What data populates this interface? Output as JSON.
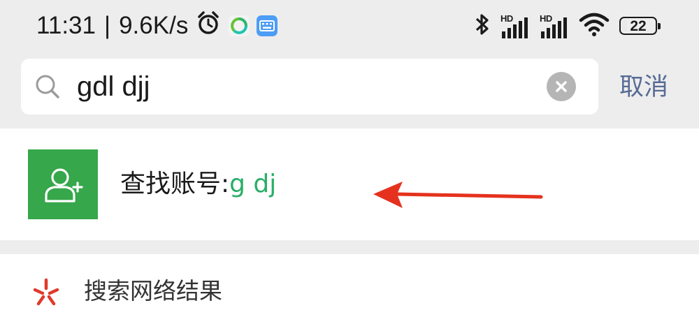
{
  "status_bar": {
    "time": "11:31",
    "separator": "|",
    "net_speed": "9.6K/s",
    "battery_percent": "22",
    "battery_level": 0.22,
    "icons": [
      "alarm-clock-icon",
      "green-app-icon",
      "keyboard-app-icon",
      "bluetooth-icon",
      "signal-hd-1-icon",
      "signal-hd-2-icon",
      "wifi-icon",
      "battery-icon"
    ],
    "signal_badge": "HD"
  },
  "search": {
    "query": "gdl djj",
    "icon": "search-icon",
    "clear_icon": "clear-icon",
    "cancel_label": "取消"
  },
  "result": {
    "icon": "add-friend-icon",
    "prefix": "查找账号:",
    "query_display": "g dj",
    "colors": {
      "icon_bg": "#36a74a",
      "query": "#2aae67"
    }
  },
  "network": {
    "icon": "network-search-icon",
    "label": "搜索网络结果",
    "colors": {
      "icon": "#e0392b"
    }
  },
  "annotation": {
    "icon": "red-arrow-icon",
    "color": "#e5321e"
  },
  "colors": {
    "background": "#ededed",
    "accent_link": "#576b95"
  }
}
